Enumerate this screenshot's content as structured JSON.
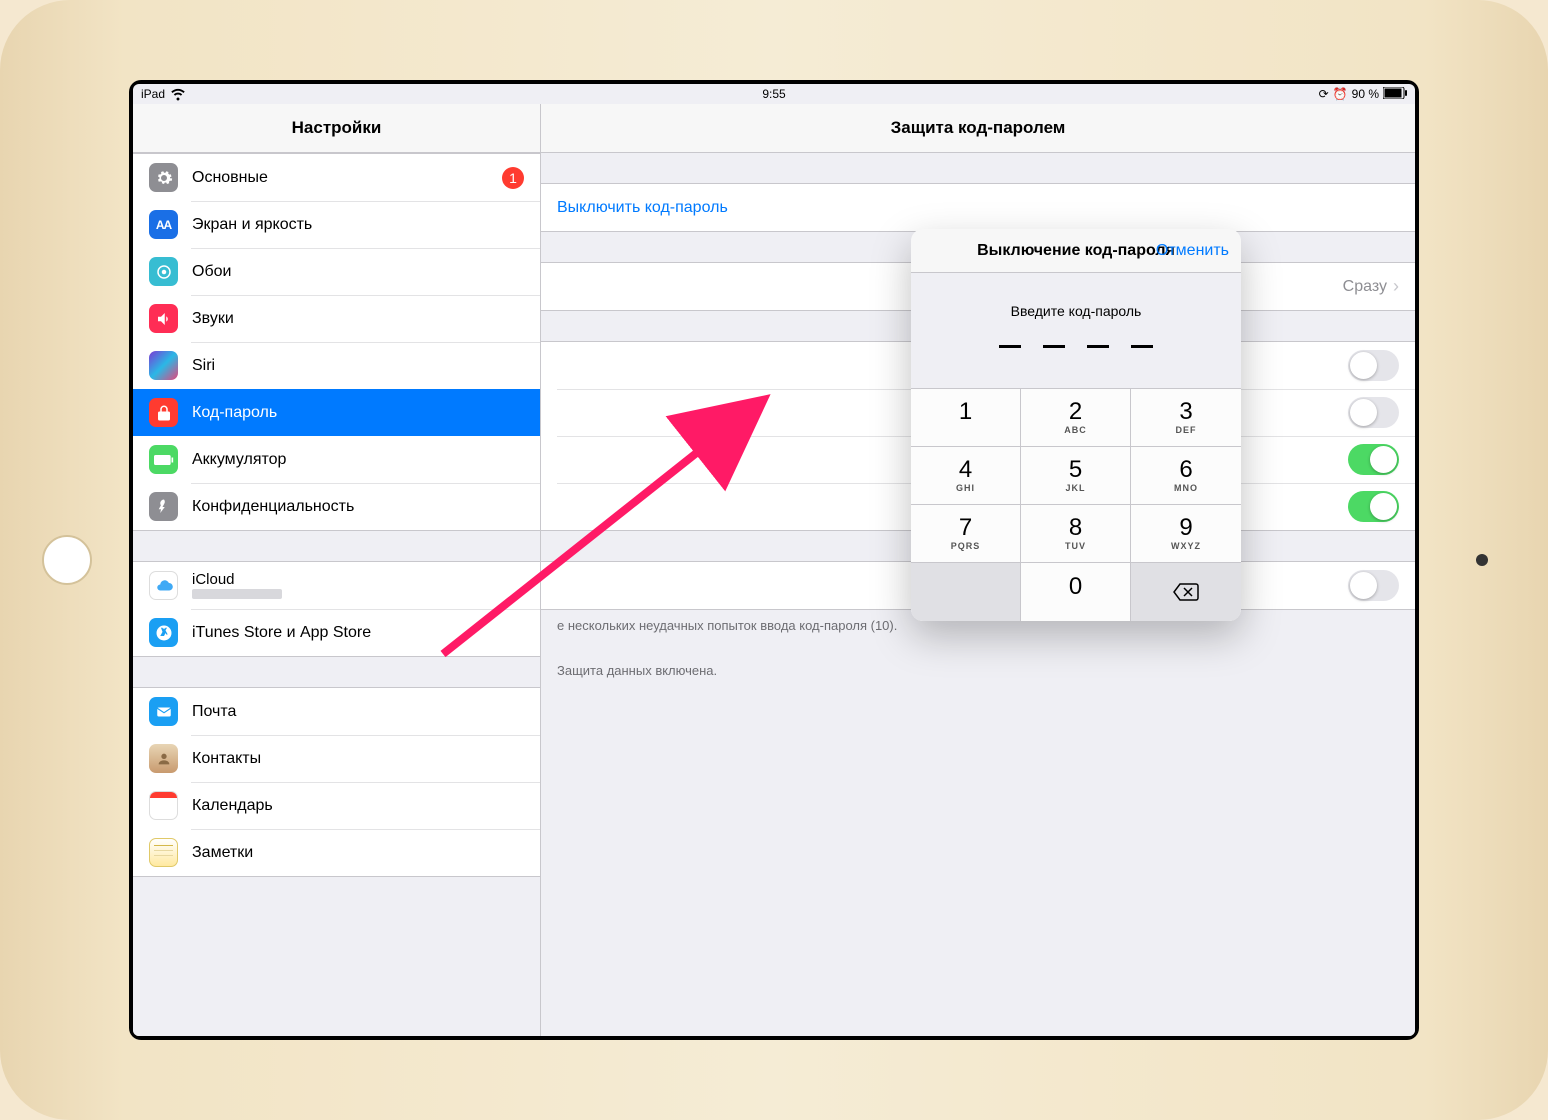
{
  "status": {
    "device": "iPad",
    "time": "9:55",
    "battery_pct": "90 %"
  },
  "sidebar": {
    "title": "Настройки",
    "groups": [
      [
        {
          "label": "Основные",
          "icon": "gear",
          "color": "#8e8e93",
          "badge": "1"
        },
        {
          "label": "Экран и яркость",
          "icon": "brightness",
          "color": "#1a6fe6"
        },
        {
          "label": "Обои",
          "icon": "wallpaper",
          "color": "#37bdd2"
        },
        {
          "label": "Звуки",
          "icon": "sounds",
          "color": "#ff2d55"
        },
        {
          "label": "Siri",
          "icon": "siri",
          "color": "#000"
        },
        {
          "label": "Код-пароль",
          "icon": "lock",
          "color": "#ff3b30",
          "selected": true
        },
        {
          "label": "Аккумулятор",
          "icon": "battery",
          "color": "#4cd964"
        },
        {
          "label": "Конфиденциальность",
          "icon": "privacy",
          "color": "#8e8e93"
        }
      ],
      [
        {
          "label": "iCloud",
          "icon": "icloud",
          "color": "#fff",
          "sub": true
        },
        {
          "label": "iTunes Store и App Store",
          "icon": "appstore",
          "color": "#1a9ff3"
        }
      ],
      [
        {
          "label": "Почта",
          "icon": "mail",
          "color": "#1a9ff3"
        },
        {
          "label": "Контакты",
          "icon": "contacts",
          "color": "#c89a6e"
        },
        {
          "label": "Календарь",
          "icon": "calendar",
          "color": "#fff"
        },
        {
          "label": "Заметки",
          "icon": "notes",
          "color": "#ffe066"
        }
      ]
    ]
  },
  "content": {
    "title": "Защита код-паролем",
    "disable_link": "Выключить код-пароль",
    "request_value": "Сразу",
    "switches": [
      false,
      false,
      true,
      true,
      false
    ],
    "footer1": "е нескольких неудачных попыток ввода код-пароля (10).",
    "footer2": "Защита данных включена."
  },
  "modal": {
    "title": "Выключение код-пароля",
    "cancel": "Отменить",
    "prompt": "Введите код-пароль",
    "keys": [
      {
        "n": "1",
        "l": ""
      },
      {
        "n": "2",
        "l": "ABC"
      },
      {
        "n": "3",
        "l": "DEF"
      },
      {
        "n": "4",
        "l": "GHI"
      },
      {
        "n": "5",
        "l": "JKL"
      },
      {
        "n": "6",
        "l": "MNO"
      },
      {
        "n": "7",
        "l": "PQRS"
      },
      {
        "n": "8",
        "l": "TUV"
      },
      {
        "n": "9",
        "l": "WXYZ"
      }
    ],
    "zero": "0"
  }
}
